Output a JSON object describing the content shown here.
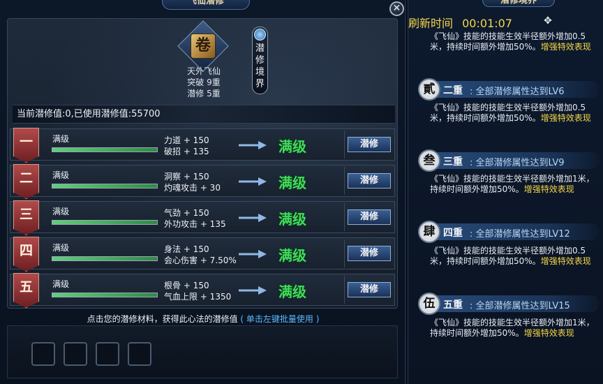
{
  "left": {
    "title": "飞仙潜修",
    "close": "✕",
    "skill": {
      "name": "天外飞仙",
      "breakthrough_label": "突破",
      "breakthrough_value": "9重",
      "latent_label": "潜修",
      "latent_value": "5重",
      "icon": "scroll-icon"
    },
    "realm_button": "潜修境界",
    "points_text": "当前潜修值:0,已使用潜修值:55700",
    "rows": [
      {
        "numeral": "一",
        "level_label": "满级",
        "progress": 1.0,
        "stat1": "力道 + 150",
        "stat2": "破招 + 135",
        "maxed": "满级",
        "button": "潜修"
      },
      {
        "numeral": "二",
        "level_label": "满级",
        "progress": 1.0,
        "stat1": "洞察 + 150",
        "stat2": "灼魂攻击 + 30",
        "maxed": "满级",
        "button": "潜修"
      },
      {
        "numeral": "三",
        "level_label": "满级",
        "progress": 1.0,
        "stat1": "气劲 + 150",
        "stat2": "外功攻击 + 135",
        "maxed": "满级",
        "button": "潜修"
      },
      {
        "numeral": "四",
        "level_label": "满级",
        "progress": 1.0,
        "stat1": "身法 + 150",
        "stat2": "会心伤害 + 7.50%",
        "maxed": "满级",
        "button": "潜修"
      },
      {
        "numeral": "五",
        "level_label": "满级",
        "progress": 1.0,
        "stat1": "根骨 + 150",
        "stat2": "气血上限 + 1350",
        "maxed": "满级",
        "button": "潜修"
      }
    ],
    "hint_text": "点击您的潜修材料，获得此心法的潜修值",
    "hint_link": "( 单击左键批量使用 )"
  },
  "right": {
    "title": "潜修境界",
    "refresh_label": "刷新时间",
    "refresh_time": "00:01:07",
    "first_desc_main": "《飞仙》技能的技能生效半径额外增加0.5米，持续时间额外增加50%。",
    "first_desc_hl": "增强特效表现",
    "realms": [
      {
        "badge": "貳",
        "level": "二重",
        "cond": ": 全部潜修属性达到LV6",
        "desc_main": "《飞仙》技能的技能生效半径额外增加0.5米，持续时间额外增加50%。",
        "desc_hl": "增强特效表现"
      },
      {
        "badge": "叁",
        "level": "三重",
        "cond": ": 全部潜修属性达到LV9",
        "desc_main": "《飞仙》技能的技能生效半径额外增加1米，持续时间额外增加50%。",
        "desc_hl": "增强特效表现"
      },
      {
        "badge": "肆",
        "level": "四重",
        "cond": ": 全部潜修属性达到LV12",
        "desc_main": "《飞仙》技能的技能生效半径额外增加0.5米，持续时间额外增加50%。",
        "desc_hl": "增强特效表现"
      },
      {
        "badge": "伍",
        "level": "五重",
        "cond": ": 全部潜修属性达到LV15",
        "desc_main": "《飞仙》技能的技能生效半径额外增加1米，持续时间额外增加50%。",
        "desc_hl": "增强特效表现"
      }
    ]
  }
}
